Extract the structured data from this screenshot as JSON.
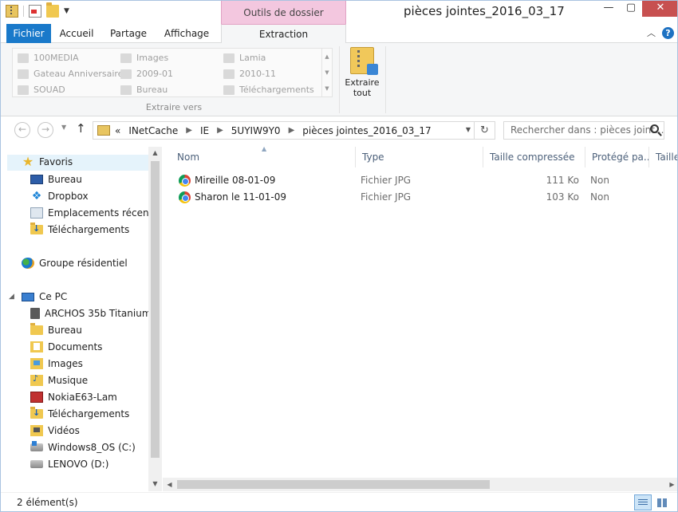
{
  "window": {
    "title": "pièces jointes_2016_03_17",
    "context_tab": "Outils de dossier compressé"
  },
  "ribbon": {
    "tabs": [
      {
        "label": "Fichier"
      },
      {
        "label": "Accueil"
      },
      {
        "label": "Partage"
      },
      {
        "label": "Affichage"
      },
      {
        "label": "Extraction"
      }
    ],
    "extract_locations": [
      "100MEDIA",
      "Gateau Anniversaire",
      "SOUAD",
      "Images",
      "2009-01",
      "Bureau",
      "Lamia",
      "2010-11",
      "Téléchargements"
    ],
    "extract_group_label": "Extraire vers",
    "extract_all_label_line1": "Extraire",
    "extract_all_label_line2": "tout"
  },
  "address": {
    "overflow": "«",
    "crumbs": [
      "INetCache",
      "IE",
      "5UYIW9Y0",
      "pièces jointes_2016_03_17"
    ]
  },
  "search": {
    "placeholder": "Rechercher dans : pièces joint..."
  },
  "navpane": {
    "favorites_label": "Favoris",
    "favorites": [
      "Bureau",
      "Dropbox",
      "Emplacements récents",
      "Téléchargements"
    ],
    "homegroup_label": "Groupe résidentiel",
    "pc_label": "Ce PC",
    "pc_items": [
      "ARCHOS 35b Titanium",
      "Bureau",
      "Documents",
      "Images",
      "Musique",
      "NokiaE63-Lam",
      "Téléchargements",
      "Vidéos",
      "Windows8_OS (C:)",
      "LENOVO (D:)"
    ]
  },
  "filelist": {
    "columns": [
      "Nom",
      "Type",
      "Taille compressée",
      "Protégé pa...",
      "Taille"
    ],
    "rows": [
      {
        "name": "Mireille 08-01-09",
        "type": "Fichier JPG",
        "size": "111 Ko",
        "protected": "Non"
      },
      {
        "name": "Sharon le 11-01-09",
        "type": "Fichier JPG",
        "size": "103 Ko",
        "protected": "Non"
      }
    ]
  },
  "status": {
    "text": "2 élément(s)"
  },
  "colors": {
    "file_tab": "#1979ca",
    "context_tab": "#f3c7df",
    "close_button": "#c75050"
  }
}
